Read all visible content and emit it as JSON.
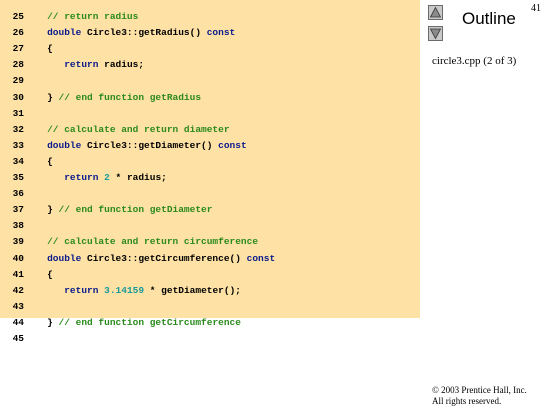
{
  "slide": {
    "page_number": "41",
    "outline_label": "Outline",
    "file_label": "circle3.cpp (2 of 3)",
    "copyright_line1": "© 2003 Prentice Hall, Inc.",
    "copyright_line2": "All rights reserved."
  },
  "nav": {
    "up_icon": "triangle-up-icon",
    "down_icon": "triangle-down-icon"
  },
  "colors": {
    "code_background": "#fde1a5",
    "comment": "#2a8a1c",
    "keyword": "#0a1a8c",
    "number": "#1a9a9a"
  },
  "code": {
    "lines": [
      {
        "num": "25",
        "tokens": [
          {
            "t": "   // return radius",
            "k": "comment"
          }
        ]
      },
      {
        "num": "26",
        "tokens": [
          {
            "t": "   double",
            "k": "keyword"
          },
          {
            "t": " Circle3::getRadius() ",
            "k": "plain"
          },
          {
            "t": "const",
            "k": "keyword"
          }
        ]
      },
      {
        "num": "27",
        "tokens": [
          {
            "t": "   {",
            "k": "plain"
          }
        ]
      },
      {
        "num": "28",
        "tokens": [
          {
            "t": "      ",
            "k": "plain"
          },
          {
            "t": "return",
            "k": "keyword"
          },
          {
            "t": " radius;",
            "k": "plain"
          }
        ]
      },
      {
        "num": "29",
        "tokens": []
      },
      {
        "num": "30",
        "tokens": [
          {
            "t": "   } ",
            "k": "plain"
          },
          {
            "t": "// end function getRadius",
            "k": "comment"
          }
        ]
      },
      {
        "num": "31",
        "tokens": []
      },
      {
        "num": "32",
        "tokens": [
          {
            "t": "   // calculate and return diameter",
            "k": "comment"
          }
        ]
      },
      {
        "num": "33",
        "tokens": [
          {
            "t": "   double",
            "k": "keyword"
          },
          {
            "t": " Circle3::getDiameter() ",
            "k": "plain"
          },
          {
            "t": "const",
            "k": "keyword"
          }
        ]
      },
      {
        "num": "34",
        "tokens": [
          {
            "t": "   {",
            "k": "plain"
          }
        ]
      },
      {
        "num": "35",
        "tokens": [
          {
            "t": "      ",
            "k": "plain"
          },
          {
            "t": "return",
            "k": "keyword"
          },
          {
            "t": " ",
            "k": "plain"
          },
          {
            "t": "2",
            "k": "number"
          },
          {
            "t": " * radius;",
            "k": "plain"
          }
        ]
      },
      {
        "num": "36",
        "tokens": []
      },
      {
        "num": "37",
        "tokens": [
          {
            "t": "   } ",
            "k": "plain"
          },
          {
            "t": "// end function getDiameter",
            "k": "comment"
          }
        ]
      },
      {
        "num": "38",
        "tokens": []
      },
      {
        "num": "39",
        "tokens": [
          {
            "t": "   // calculate and return circumference",
            "k": "comment"
          }
        ]
      },
      {
        "num": "40",
        "tokens": [
          {
            "t": "   double",
            "k": "keyword"
          },
          {
            "t": " Circle3::getCircumference() ",
            "k": "plain"
          },
          {
            "t": "const",
            "k": "keyword"
          }
        ]
      },
      {
        "num": "41",
        "tokens": [
          {
            "t": "   {",
            "k": "plain"
          }
        ]
      },
      {
        "num": "42",
        "tokens": [
          {
            "t": "      ",
            "k": "plain"
          },
          {
            "t": "return",
            "k": "keyword"
          },
          {
            "t": " ",
            "k": "plain"
          },
          {
            "t": "3.14159",
            "k": "number"
          },
          {
            "t": " * getDiameter();",
            "k": "plain"
          }
        ]
      },
      {
        "num": "43",
        "tokens": []
      },
      {
        "num": "44",
        "tokens": [
          {
            "t": "   } ",
            "k": "plain"
          },
          {
            "t": "// end function getCircumference",
            "k": "comment"
          }
        ]
      },
      {
        "num": "45",
        "tokens": []
      }
    ]
  }
}
